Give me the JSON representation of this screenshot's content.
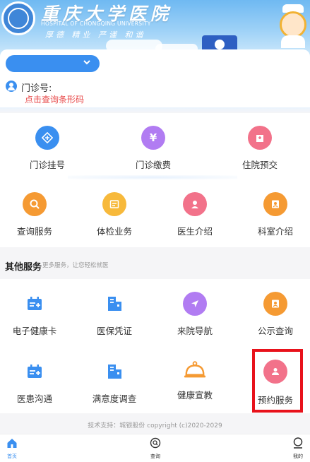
{
  "header": {
    "hospital_name_cn": "重庆大学医院",
    "hospital_name_en": "HOSPITAL OF CHONGQING UNIVERSITY",
    "motto": "厚德 精业 严谨 和谐"
  },
  "patient": {
    "selector_value": "",
    "clinic_no_label": "门诊号:",
    "barcode_link": "点击查询条形码"
  },
  "main_services": [
    {
      "label": "门诊挂号",
      "icon": "plus-icon",
      "color": "#3a8ff0"
    },
    {
      "label": "门诊缴费",
      "icon": "yen-icon",
      "color": "#b17cf2"
    },
    {
      "label": "住院预交",
      "icon": "hospital-icon",
      "color": "#f2728a"
    },
    {
      "label": "查询服务",
      "icon": "search-icon",
      "color": "#f59a33"
    },
    {
      "label": "体检业务",
      "icon": "checkup-icon",
      "color": "#f7b93b"
    },
    {
      "label": "医生介绍",
      "icon": "doctor-icon",
      "color": "#f2728a"
    },
    {
      "label": "科室介绍",
      "icon": "department-icon",
      "color": "#f59a33"
    }
  ],
  "other_services": {
    "title": "其他服务",
    "subtitle": "更多服务，让您轻松就医",
    "items": [
      {
        "label": "电子健康卡",
        "icon": "health-card-icon",
        "color": "#3a8ff0"
      },
      {
        "label": "医保凭证",
        "icon": "insurance-icon",
        "color": "#3a8ff0"
      },
      {
        "label": "来院导航",
        "icon": "navigation-icon",
        "color": "#b17cf2"
      },
      {
        "label": "公示查询",
        "icon": "notice-icon",
        "color": "#f59a33"
      },
      {
        "label": "医患沟通",
        "icon": "communication-icon",
        "color": "#3a8ff0"
      },
      {
        "label": "满意度调查",
        "icon": "survey-icon",
        "color": "#3a8ff0"
      },
      {
        "label": "健康宣教",
        "icon": "education-icon",
        "color": "#f59a33"
      },
      {
        "label": "预约服务",
        "icon": "appointment-icon",
        "color": "#f2728a"
      }
    ]
  },
  "footer": {
    "support": "技术支持：城银股份 copyright (c)2020-2029"
  },
  "tabbar": [
    {
      "label": "首页",
      "icon": "home-icon",
      "active": true
    },
    {
      "label": "查询",
      "icon": "search-icon",
      "active": false
    },
    {
      "label": "我的",
      "icon": "profile-icon",
      "active": false
    }
  ],
  "colors": {
    "accent": "#3a8ff0",
    "highlight": "#e8121b",
    "link": "#e84b4b"
  }
}
